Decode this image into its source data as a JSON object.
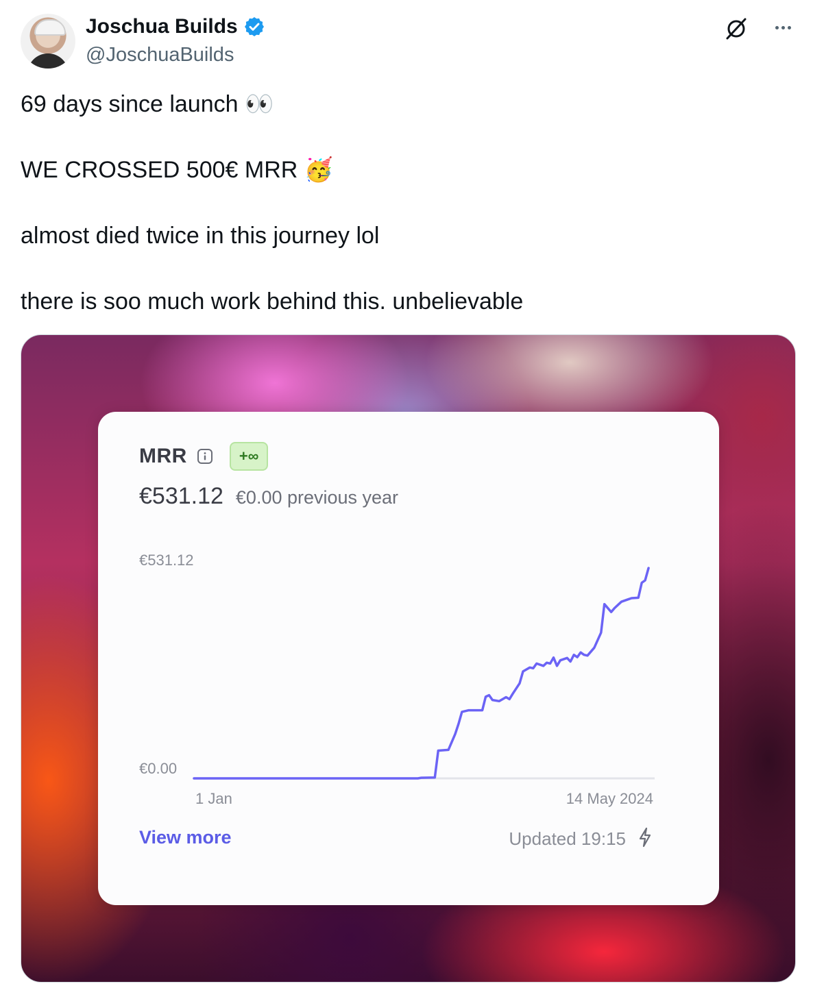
{
  "post": {
    "display_name": "Joschua Builds",
    "handle": "@JoschuaBuilds",
    "verified": true,
    "text_lines": [
      "69 days since launch 👀",
      "",
      "WE CROSSED 500€ MRR 🥳",
      "",
      "almost died twice in this journey lol",
      "",
      "there is soo much work behind this. unbelievable"
    ],
    "icons": {
      "avatar": "avatar",
      "verified": "verified-badge-icon",
      "grok": "grok-icon",
      "more": "more-options-icon"
    }
  },
  "card": {
    "title": "MRR",
    "badge": "+∞",
    "current_value": "€531.12",
    "previous_value": "€0.00 previous year",
    "view_more": "View more",
    "updated": "Updated 19:15",
    "accent_color": "#5b5ce6"
  },
  "chart_data": {
    "type": "line",
    "title": "MRR",
    "x_tick_labels": [
      "1 Jan",
      "14 May 2024"
    ],
    "y_tick_labels": [
      "€531.12",
      "€0.00"
    ],
    "ylim": [
      0,
      531.12
    ],
    "x_range_days": [
      0,
      135
    ],
    "series": [
      {
        "name": "",
        "color": "#6b63f5",
        "points": [
          [
            0,
            0
          ],
          [
            66,
            0
          ],
          [
            67,
            1.5
          ],
          [
            71,
            2
          ],
          [
            72,
            70
          ],
          [
            75,
            72
          ],
          [
            77,
            112
          ],
          [
            78,
            138
          ],
          [
            79,
            168
          ],
          [
            81,
            172
          ],
          [
            85,
            172
          ],
          [
            86,
            206
          ],
          [
            87,
            210
          ],
          [
            88,
            198
          ],
          [
            90,
            195
          ],
          [
            92,
            205
          ],
          [
            93,
            200
          ],
          [
            94,
            214
          ],
          [
            96,
            240
          ],
          [
            97,
            270
          ],
          [
            99,
            280
          ],
          [
            100,
            278
          ],
          [
            101,
            290
          ],
          [
            103,
            284
          ],
          [
            104,
            292
          ],
          [
            105,
            290
          ],
          [
            106,
            305
          ],
          [
            107,
            284
          ],
          [
            108,
            298
          ],
          [
            110,
            304
          ],
          [
            111,
            295
          ],
          [
            112,
            312
          ],
          [
            113,
            306
          ],
          [
            114,
            318
          ],
          [
            115,
            312
          ],
          [
            116,
            310
          ],
          [
            118,
            330
          ],
          [
            120,
            368
          ],
          [
            121,
            440
          ],
          [
            123,
            420
          ],
          [
            124,
            430
          ],
          [
            126,
            446
          ],
          [
            128,
            452
          ],
          [
            129,
            455
          ],
          [
            131,
            456
          ],
          [
            132,
            494
          ],
          [
            133,
            500
          ],
          [
            134,
            531.12
          ]
        ]
      }
    ],
    "grid": false
  }
}
